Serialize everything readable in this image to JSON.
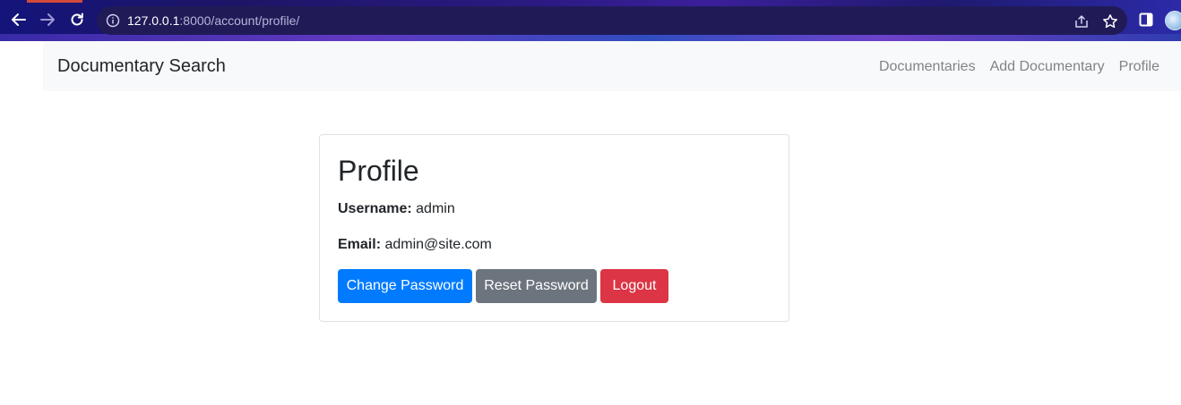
{
  "browser": {
    "url_host": "127.0.0.1",
    "url_rest": ":8000/account/profile/",
    "accent": "#201b57"
  },
  "navbar": {
    "brand": "Documentary Search",
    "links": [
      {
        "label": "Documentaries"
      },
      {
        "label": "Add Documentary"
      },
      {
        "label": "Profile"
      }
    ]
  },
  "profile": {
    "title": "Profile",
    "username_label": "Username:",
    "username_value": "admin",
    "email_label": "Email:",
    "email_value": "admin@site.com"
  },
  "actions": {
    "change_password": "Change Password",
    "reset_password": "Reset Password",
    "logout": "Logout"
  },
  "colors": {
    "primary": "#007bff",
    "secondary": "#6c757d",
    "danger": "#dc3545"
  },
  "icons": {
    "back": "arrow-left-icon",
    "forward": "arrow-right-icon",
    "reload": "reload-icon",
    "site_info": "info-icon",
    "share": "share-icon",
    "bookmark": "star-icon",
    "side_panel": "side-panel-icon",
    "profile": "avatar"
  }
}
